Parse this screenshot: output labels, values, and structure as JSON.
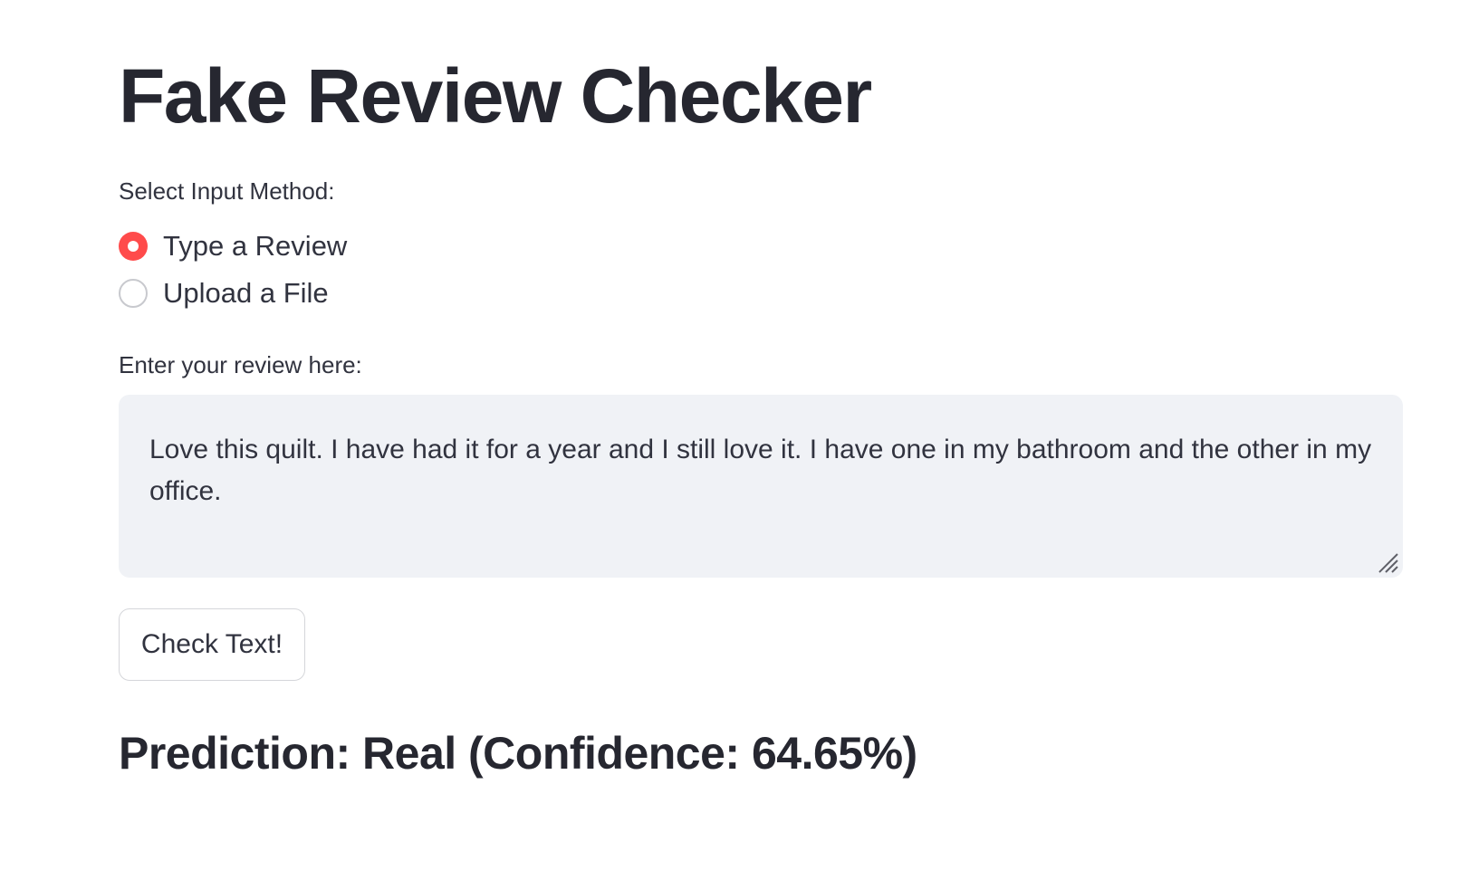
{
  "app": {
    "title": "Fake Review Checker"
  },
  "input_method": {
    "label": "Select Input Method:",
    "options": [
      {
        "label": "Type a Review",
        "selected": true
      },
      {
        "label": "Upload a File",
        "selected": false
      }
    ]
  },
  "review_input": {
    "label": "Enter your review here:",
    "value": "Love this quilt. I have had it for a year and I still love it. I have one in my bathroom and the other in my office."
  },
  "actions": {
    "check_label": "Check Text!"
  },
  "result": {
    "text": "Prediction: Real (Confidence: 64.65%)"
  },
  "colors": {
    "accent": "#ff4b4b",
    "text": "#31333f",
    "input_bg": "#f0f2f6"
  }
}
